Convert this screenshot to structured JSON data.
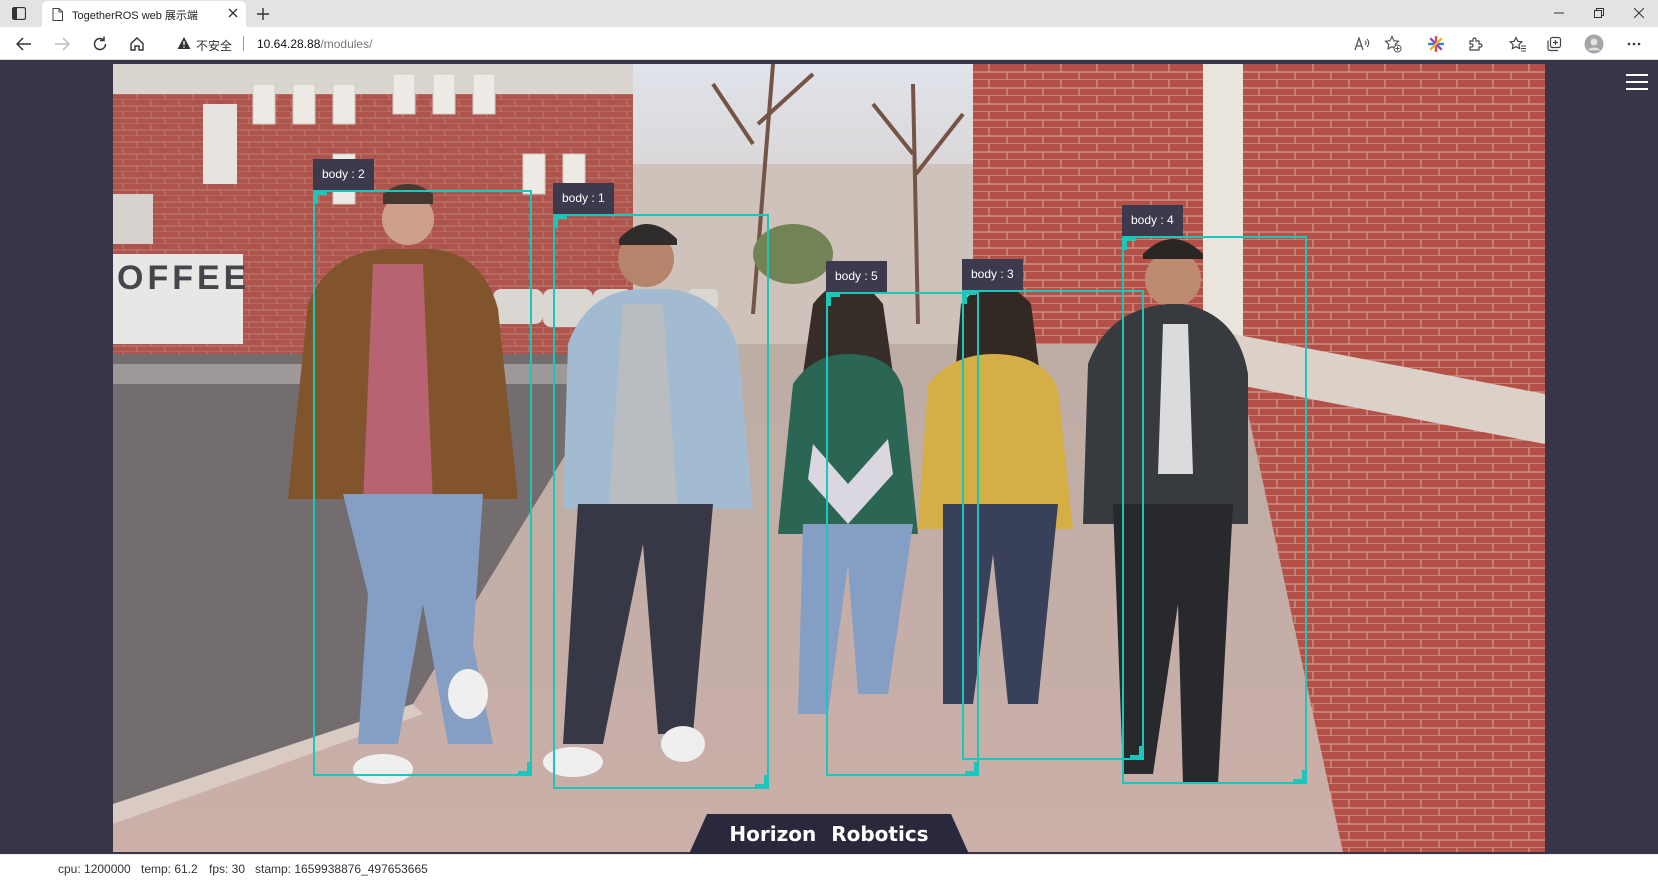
{
  "browser": {
    "tab_title": "TogetherROS web 展示端",
    "insecure_label": "不安全",
    "url_host": "10.64.28.88",
    "url_path": "/modules/"
  },
  "detections": [
    {
      "label": "body : 2"
    },
    {
      "label": "body : 1"
    },
    {
      "label": "body : 5"
    },
    {
      "label": "body : 3"
    },
    {
      "label": "body : 4"
    }
  ],
  "brand": "Horizon  Robotics",
  "status": {
    "cpu": "cpu: 1200000",
    "temp": "temp: 61.2",
    "fps": "fps: 30",
    "stamp": "stamp: 1659938876_497653665"
  },
  "colors": {
    "bbox": "#1cc7ba",
    "page_bg": "#393548",
    "label_bg": "#3c3a4c"
  },
  "icons": [
    "tab-actions-icon",
    "page-icon",
    "close-icon",
    "plus-icon",
    "minimize-icon",
    "restore-icon",
    "back-icon",
    "forward-icon",
    "refresh-icon",
    "home-icon",
    "warning-icon",
    "read-aloud-icon",
    "add-favorite-icon",
    "extension-colorful-icon",
    "extensions-icon",
    "favorites-icon",
    "collections-icon",
    "profile-icon",
    "more-icon",
    "hamburger-menu-icon"
  ]
}
